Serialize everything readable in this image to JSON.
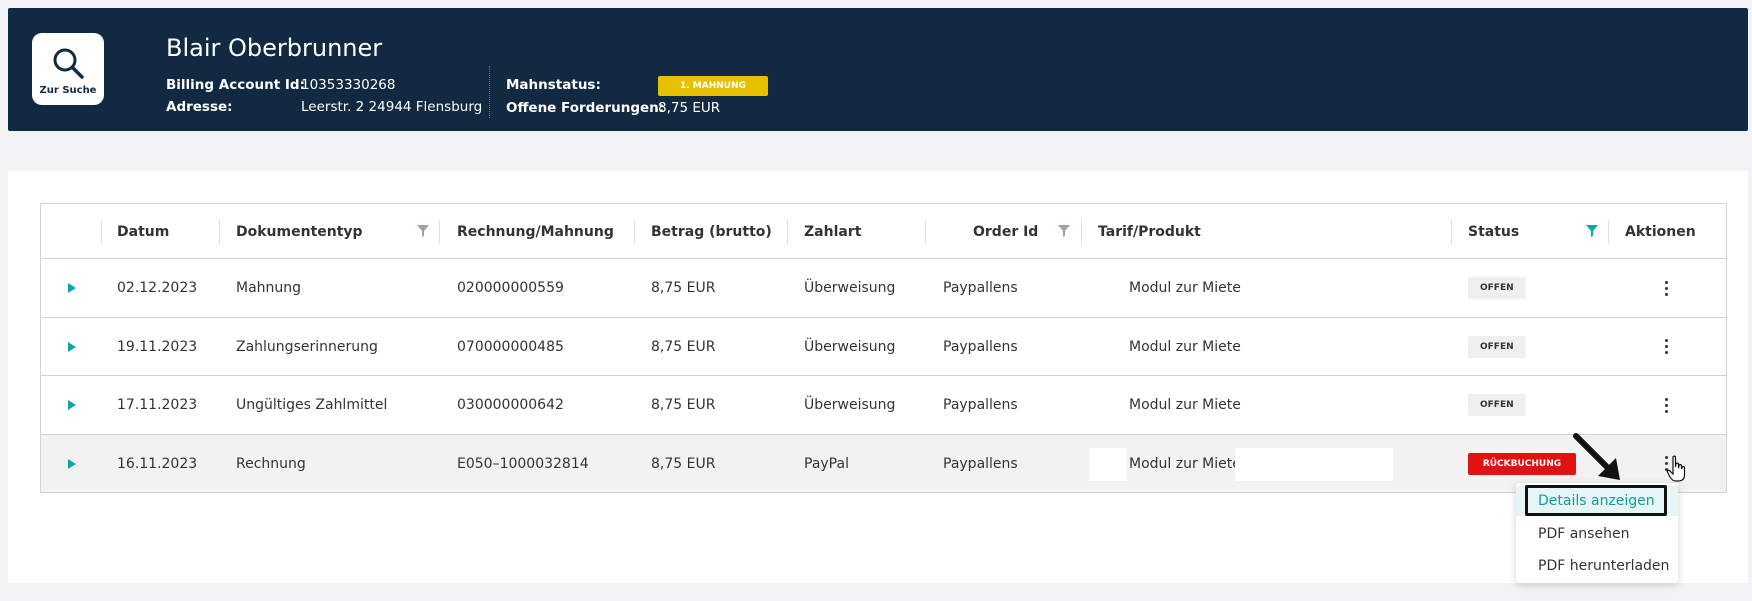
{
  "header": {
    "search_label": "Zur Suche",
    "customer_name": "Blair Oberbrunner",
    "billing_account_label": "Billing Account Id:",
    "billing_account_value": "10353330268",
    "address_label": "Adresse:",
    "address_value": "Leerstr. 2 24944 Flensburg",
    "mahnstatus_label": "Mahnstatus:",
    "mahnstatus_value": "1. MAHNUNG",
    "offene_label": "Offene Forderungen:",
    "offene_value": "8,75 EUR"
  },
  "table": {
    "columns": [
      "Datum",
      "Dokumententyp",
      "Rechnung/Mahnung",
      "Betrag (brutto)",
      "Zahlart",
      "Order Id",
      "Tarif/Produkt",
      "Status",
      "Aktionen"
    ],
    "rows": [
      {
        "datum": "02.12.2023",
        "typ": "Mahnung",
        "nummer": "020000000559",
        "betrag": "8,75 EUR",
        "zahlart": "Überweisung",
        "order": "Paypallens",
        "tarif": "Modul zur Miete",
        "status": "OFFEN"
      },
      {
        "datum": "19.11.2023",
        "typ": "Zahlungserinnerung",
        "nummer": "070000000485",
        "betrag": "8,75 EUR",
        "zahlart": "Überweisung",
        "order": "Paypallens",
        "tarif": "Modul zur Miete",
        "status": "OFFEN"
      },
      {
        "datum": "17.11.2023",
        "typ": "Ungültiges Zahlmittel",
        "nummer": "030000000642",
        "betrag": "8,75 EUR",
        "zahlart": "Überweisung",
        "order": "Paypallens",
        "tarif": "Modul zur Miete",
        "status": "OFFEN"
      },
      {
        "datum": "16.11.2023",
        "typ": "Rechnung",
        "nummer": "E050–1000032814",
        "betrag": "8,75 EUR",
        "zahlart": "PayPal",
        "order": "Paypallens",
        "tarif": "Modul zur Miete",
        "status": "RÜCKBUCHUNG"
      }
    ]
  },
  "menu": {
    "items": [
      "Details anzeigen",
      "PDF ansehen",
      "PDF herunterladen"
    ]
  },
  "colors": {
    "header_bg": "#112a41",
    "accent": "#0fa6a6",
    "mahnung_badge": "#e5c100",
    "rueckbuchung": "#e31212"
  }
}
